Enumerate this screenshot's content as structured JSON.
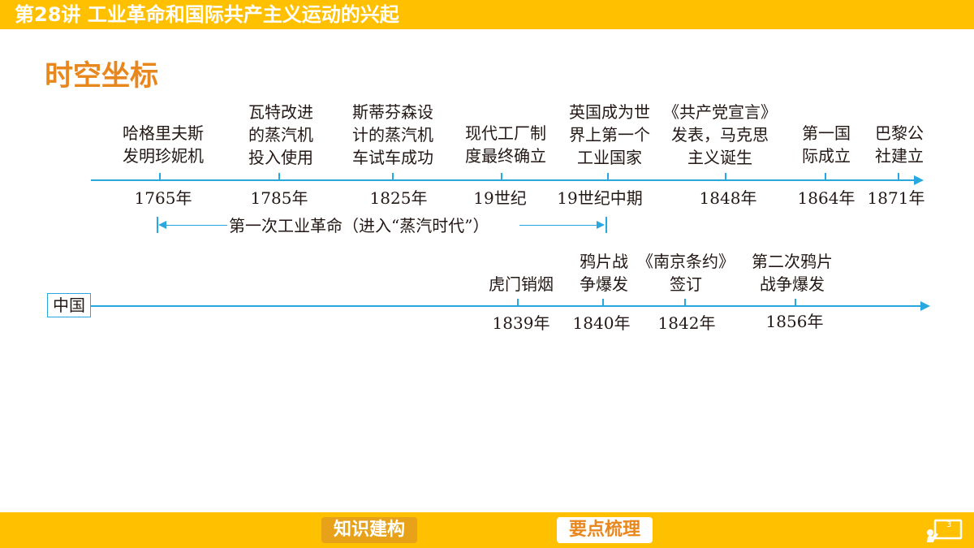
{
  "header": {
    "title": "第28讲 工业革命和国际共产主义运动的兴起"
  },
  "section": {
    "title": "时空坐标"
  },
  "world_timeline": {
    "events": [
      {
        "text": "哈格里夫斯\n发明珍妮机",
        "year": "1765年"
      },
      {
        "text": "瓦特改进\n的蒸汽机\n投入使用",
        "year": "1785年"
      },
      {
        "text": "斯蒂芬森设\n计的蒸汽机\n车试车成功",
        "year": "1825年"
      },
      {
        "text": "现代工厂制\n度最终确立",
        "year": "19世纪"
      },
      {
        "text": "英国成为世\n界上第一个\n工业国家",
        "year": "19世纪中期"
      },
      {
        "text": "《共产党宣言》\n发表，马克思\n主义诞生",
        "year": "1848年"
      },
      {
        "text": "第一国\n际成立",
        "year": "1864年"
      },
      {
        "text": "巴黎公\n社建立",
        "year": "1871年"
      }
    ],
    "span_label": "第一次工业革命（进入“蒸汽时代”）"
  },
  "china_timeline": {
    "label": "中国",
    "events": [
      {
        "text": "虎门销烟",
        "year": "1839年"
      },
      {
        "text": "鸦片战\n争爆发",
        "year": "1840年"
      },
      {
        "text": "《南京条约》\n签订",
        "year": "1842年"
      },
      {
        "text": "第二次鸦片\n战争爆发",
        "year": "1856年"
      }
    ]
  },
  "footer": {
    "knowledge_button": "知识建构",
    "keypoints_button": "要点梳理",
    "page_number": "3",
    "icon": "whiteboard-icon"
  },
  "colors": {
    "bar": "#ffc000",
    "accent": "#e8871e",
    "axis": "#29a8df"
  }
}
